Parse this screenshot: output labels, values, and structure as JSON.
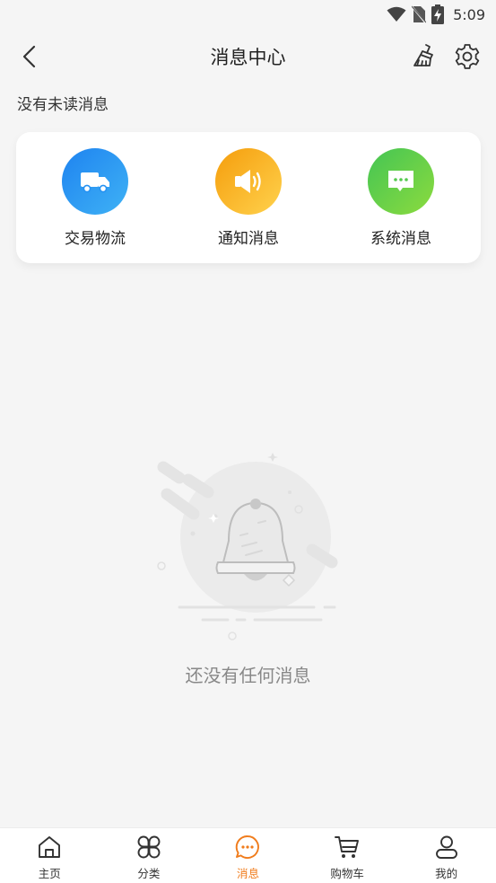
{
  "status_bar": {
    "time": "5:09",
    "icons": [
      "wifi-icon",
      "no-sim-icon",
      "battery-charging-icon"
    ]
  },
  "header": {
    "title": "消息中心",
    "back_icon": "chevron-left-icon",
    "clear_icon": "broom-icon",
    "settings_icon": "gear-icon"
  },
  "unread_text": "没有未读消息",
  "categories": [
    {
      "label": "交易物流",
      "icon": "truck-icon",
      "colors": [
        "#1e83f0",
        "#3fb2f5"
      ]
    },
    {
      "label": "通知消息",
      "icon": "speaker-icon",
      "colors": [
        "#f59d0c",
        "#ffd24d"
      ]
    },
    {
      "label": "系统消息",
      "icon": "chat-bubble-icon",
      "colors": [
        "#44c554",
        "#8cdb3e"
      ]
    }
  ],
  "empty": {
    "text": "还没有任何消息",
    "icon": "bell-empty-illustration"
  },
  "tabs": [
    {
      "label": "主页",
      "icon": "home-icon",
      "active": false
    },
    {
      "label": "分类",
      "icon": "category-icon",
      "active": false
    },
    {
      "label": "消息",
      "icon": "message-icon",
      "active": true
    },
    {
      "label": "购物车",
      "icon": "cart-icon",
      "active": false
    },
    {
      "label": "我的",
      "icon": "user-icon",
      "active": false
    }
  ],
  "colors": {
    "accent": "#f07c1c",
    "background": "#f5f5f5"
  }
}
